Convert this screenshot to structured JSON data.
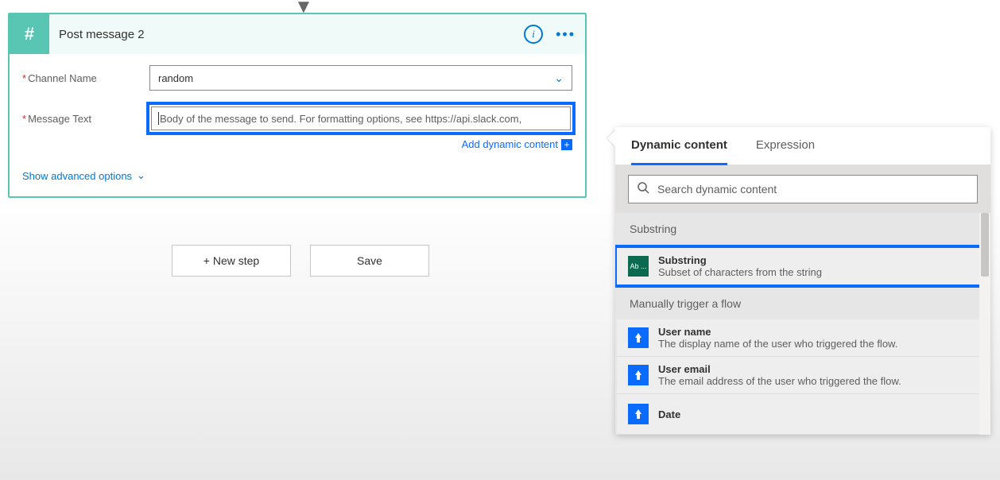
{
  "card": {
    "title": "Post message 2",
    "fields": {
      "channel_label": "Channel Name",
      "channel_value": "random",
      "message_label": "Message Text",
      "message_placeholder": "Body of the message to send. For formatting options, see https://api.slack.com,"
    },
    "add_dynamic": "Add dynamic content",
    "advanced": "Show advanced options"
  },
  "buttons": {
    "new_step": "+ New step",
    "save": "Save"
  },
  "panel": {
    "tabs": {
      "dynamic": "Dynamic content",
      "expression": "Expression"
    },
    "search_placeholder": "Search dynamic content",
    "sections": [
      {
        "title": "Substring",
        "items": [
          {
            "icon": "Ab ...",
            "icon_style": "green",
            "title": "Substring",
            "sub": "Subset of characters from the string",
            "highlight": true
          }
        ]
      },
      {
        "title": "Manually trigger a flow",
        "items": [
          {
            "icon": "👆",
            "icon_style": "blue",
            "title": "User name",
            "sub": "The display name of the user who triggered the flow."
          },
          {
            "icon": "👆",
            "icon_style": "blue",
            "title": "User email",
            "sub": "The email address of the user who triggered the flow."
          },
          {
            "icon": "👆",
            "icon_style": "blue",
            "title": "Date",
            "sub": ""
          }
        ]
      }
    ]
  }
}
